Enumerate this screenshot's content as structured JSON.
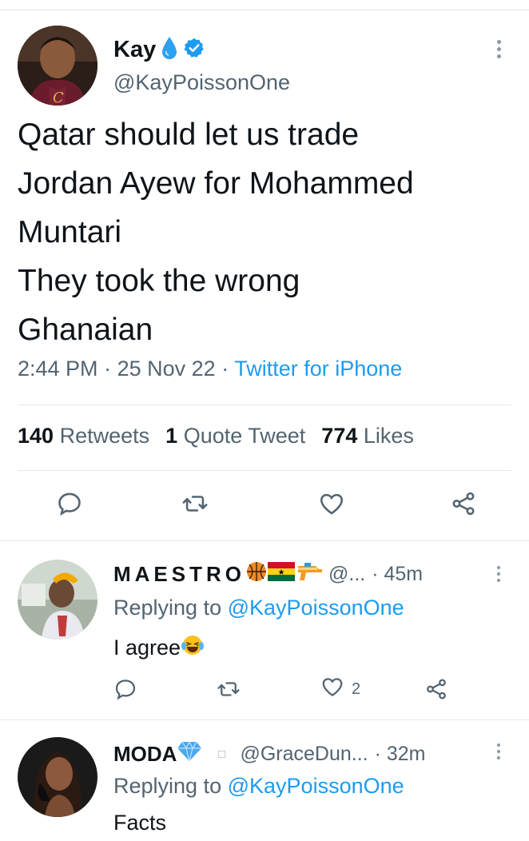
{
  "main_tweet": {
    "display_name": "Kay",
    "handle": "@KayPoissonOne",
    "text_lines": [
      "Qatar should let us trade",
      "Jordan Ayew for Mohammed",
      "Muntari",
      "They took the wrong",
      "Ghanaian"
    ],
    "time": "2:44 PM",
    "date": "25 Nov 22",
    "source": "Twitter for iPhone",
    "retweets_count": "140",
    "retweets_label": "Retweets",
    "quotes_count": "1",
    "quotes_label": "Quote Tweet",
    "likes_count": "774",
    "likes_label": "Likes",
    "colors": {
      "accent": "#1d9bf0",
      "verified": "#1d9bf0",
      "secondary_text": "#536471"
    },
    "icons": [
      "droplet-emoji",
      "verified-badge-icon",
      "more-icon",
      "reply-icon",
      "retweet-icon",
      "like-icon",
      "share-icon"
    ]
  },
  "replies": [
    {
      "display_name": "MAESTRO",
      "name_emojis": [
        "basketball-emoji",
        "ghana-flag-emoji",
        "water-pistol-emoji"
      ],
      "handle": "@...",
      "time": "· 45m",
      "replying_label": "Replying to",
      "replying_to": "@KayPoissonOne",
      "text": "I agree",
      "text_emoji": "laughing-tears-emoji",
      "like_count": "2"
    },
    {
      "display_name": "MODA",
      "name_emojis": [
        "gem-emoji"
      ],
      "handle": "@GraceDun...",
      "time": "· 32m",
      "replying_label": "Replying to",
      "replying_to": "@KayPoissonOne",
      "text": "Facts"
    }
  ]
}
